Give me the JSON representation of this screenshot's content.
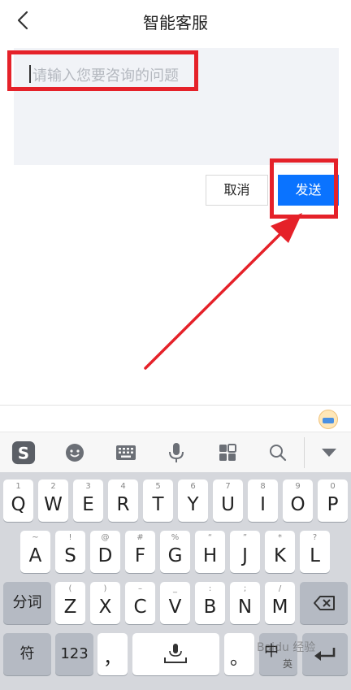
{
  "header": {
    "title": "智能客服"
  },
  "input": {
    "placeholder": "请输入您要咨询的问题"
  },
  "actions": {
    "cancel_label": "取消",
    "send_label": "发送",
    "send_color": "#0a73ff"
  },
  "annotation_color": "#e52129",
  "keyboard": {
    "toolbar_icons": [
      "sogou-logo-icon",
      "emoji-icon",
      "keyboard-icon",
      "microphone-icon",
      "grid-apps-icon",
      "search-icon",
      "collapse-icon"
    ],
    "row1": [
      {
        "k": "Q",
        "s": "1"
      },
      {
        "k": "W",
        "s": "2"
      },
      {
        "k": "E",
        "s": "3"
      },
      {
        "k": "R",
        "s": "4"
      },
      {
        "k": "T",
        "s": "5"
      },
      {
        "k": "Y",
        "s": "6"
      },
      {
        "k": "U",
        "s": "7"
      },
      {
        "k": "I",
        "s": "8"
      },
      {
        "k": "O",
        "s": "9"
      },
      {
        "k": "P",
        "s": "0"
      }
    ],
    "row2": [
      {
        "k": "A",
        "s": "~"
      },
      {
        "k": "S",
        "s": "!"
      },
      {
        "k": "D",
        "s": "@"
      },
      {
        "k": "F",
        "s": "#"
      },
      {
        "k": "G",
        "s": "%"
      },
      {
        "k": "H",
        "s": "“"
      },
      {
        "k": "J",
        "s": "”"
      },
      {
        "k": "K",
        "s": "*"
      },
      {
        "k": "L",
        "s": "?"
      }
    ],
    "row3": [
      {
        "k": "Z",
        "s": "("
      },
      {
        "k": "X",
        "s": ")"
      },
      {
        "k": "C",
        "s": "–"
      },
      {
        "k": "V",
        "s": "_"
      },
      {
        "k": "B",
        "s": ":"
      },
      {
        "k": "N",
        "s": ";"
      },
      {
        "k": "M",
        "s": "/"
      }
    ],
    "fenci_label": "分词",
    "symbol_label": "符",
    "num_label": "123",
    "comma_label": "，",
    "period_label": "。",
    "lang_label": "中",
    "lang_sub": "英"
  },
  "watermark": "Baidu 经验"
}
